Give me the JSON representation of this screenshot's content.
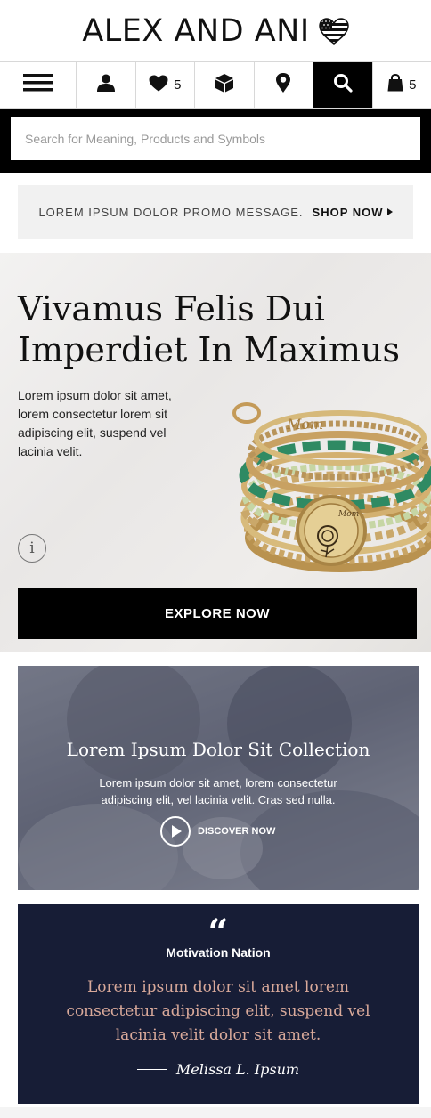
{
  "header": {
    "logo_text": "ALEX AND ANI",
    "logo_icon": "flag-heart-icon"
  },
  "nav": {
    "wishlist_count": "5",
    "cart_count": "5",
    "icons": [
      "menu-icon",
      "account-icon",
      "heart-icon",
      "box-icon",
      "location-pin-icon",
      "search-icon",
      "shopping-bag-icon"
    ]
  },
  "search": {
    "placeholder": "Search for Meaning, Products and Symbols"
  },
  "promo": {
    "message": "LOREM IPSUM DOLOR PROMO MESSAGE.",
    "link_label": "SHOP NOW"
  },
  "hero": {
    "title": "Vivamus Felis Dui Imperdiet In Maximus",
    "text": "Lorem ipsum dolor sit amet, lorem consectetur lorem sit adipiscing elit, suspend vel lacinia velit.",
    "cta_label": "EXPLORE NOW",
    "charm_text": "Mom",
    "bangle_text": "Mom"
  },
  "collection": {
    "title": "Lorem Ipsum Dolor Sit Collection",
    "text": "Lorem ipsum dolor sit amet, lorem consectetur adipiscing elit, vel lacinia velit. Cras sed nulla.",
    "cta_label": "DISCOVER NOW"
  },
  "quote": {
    "mark": "“",
    "label": "Motivation Nation",
    "text": "Lorem ipsum dolor sit amet lorem consectetur adipiscing elit, suspend vel lacinia velit dolor sit amet.",
    "author": "Melissa L. Ipsum"
  },
  "colors": {
    "brand_black": "#000000",
    "quote_bg": "#171d36",
    "quote_text": "#d9a99a",
    "promo_bg": "#f1f1f1"
  }
}
